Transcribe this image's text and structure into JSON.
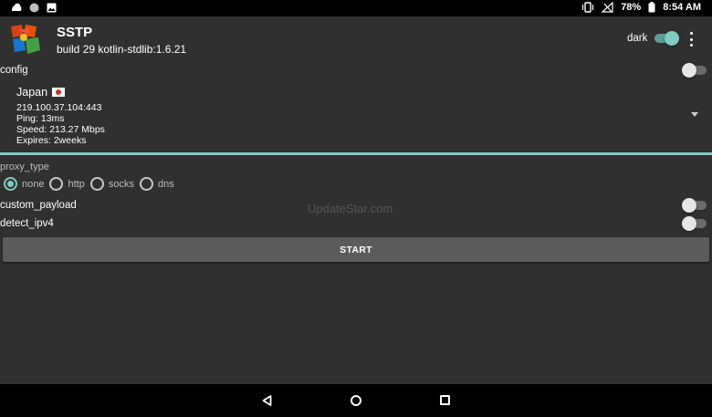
{
  "status_bar": {
    "battery": "78%",
    "time": "8:54 AM"
  },
  "header": {
    "title": "SSTP",
    "subtitle": "build 29 kotlin-stdlib:1.6.21",
    "dark_label": "dark",
    "dark_on": true
  },
  "config": {
    "label": "config",
    "enabled": false
  },
  "server": {
    "name": "Japan",
    "address": "219.100.37.104:443",
    "ping": "Ping: 13ms",
    "speed": "Speed: 213.27 Mbps",
    "expires": "Expires: 2weeks"
  },
  "proxy": {
    "label": "proxy_type",
    "options": [
      "none",
      "http",
      "socks",
      "dns"
    ],
    "selected": "none"
  },
  "custom_payload": {
    "label": "custom_payload",
    "enabled": false
  },
  "detect_ipv4": {
    "label": "detect_ipv4",
    "enabled": false
  },
  "watermark": "UpdateStar.com",
  "start_label": "START",
  "colors": {
    "accent": "#80cbc4",
    "background": "#303030",
    "button": "#5b5b5b"
  }
}
